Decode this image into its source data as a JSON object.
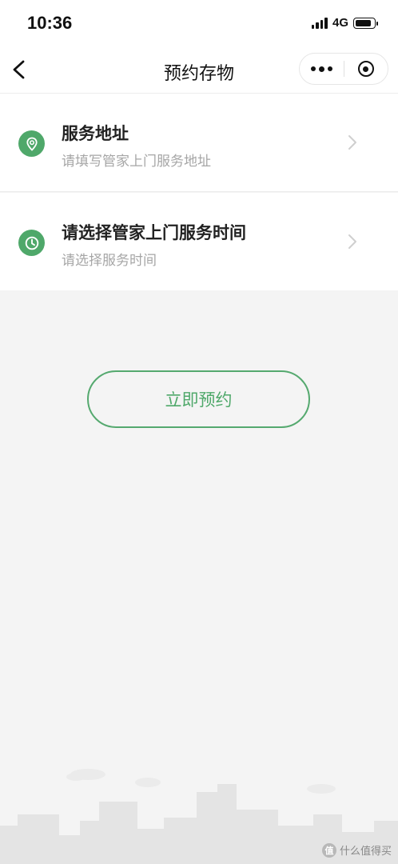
{
  "status_bar": {
    "time": "10:36",
    "network": "4G",
    "battery_level": 0.9
  },
  "nav": {
    "title": "预约存物"
  },
  "rows": [
    {
      "title": "服务地址",
      "subtitle": "请填写管家上门服务地址",
      "icon": "location-pin-icon"
    },
    {
      "title": "请选择管家上门服务时间",
      "subtitle": "请选择服务时间",
      "icon": "clock-icon"
    }
  ],
  "action": {
    "reserve_label": "立即预约"
  },
  "watermark": {
    "text": "什么值得买",
    "logo": "值"
  },
  "colors": {
    "accent": "#4fa86a",
    "background": "#f4f4f4",
    "subtext": "#a6a6a6"
  }
}
